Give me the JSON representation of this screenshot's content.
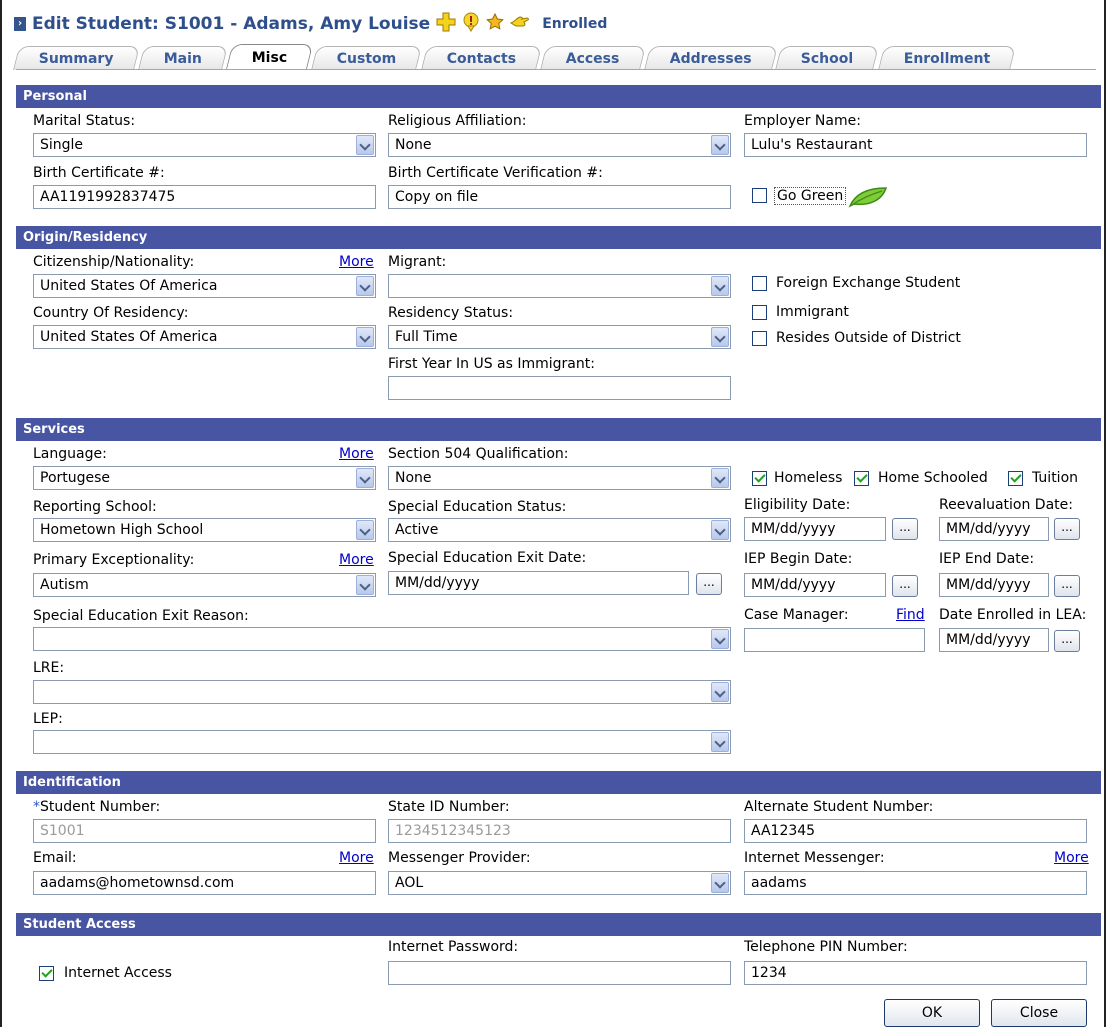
{
  "header": {
    "title": "Edit Student: S1001 - Adams, Amy Louise",
    "status": "Enrolled",
    "icons": [
      "plus-icon",
      "alert-icon",
      "star-icon",
      "hand-icon"
    ]
  },
  "tabs": [
    "Summary",
    "Main",
    "Misc",
    "Custom",
    "Contacts",
    "Access",
    "Addresses",
    "School",
    "Enrollment"
  ],
  "active_tab": "Misc",
  "personal": {
    "header": "Personal",
    "marital_status_label": "Marital Status:",
    "marital_status_value": "Single",
    "religious_label": "Religious Affiliation:",
    "religious_value": "None",
    "employer_label": "Employer Name:",
    "employer_value": "Lulu's Restaurant",
    "birth_cert_label": "Birth Certificate #:",
    "birth_cert_value": "AA1191992837475",
    "birth_verif_label": "Birth Certificate Verification #:",
    "birth_verif_value": "Copy on file",
    "go_green_label": "Go Green"
  },
  "origin": {
    "header": "Origin/Residency",
    "citizenship_label": "Citizenship/Nationality:",
    "more_label": "More",
    "citizenship_value": "United States Of America",
    "migrant_label": "Migrant:",
    "migrant_value": "",
    "foreign_exchange_label": "Foreign Exchange Student",
    "country_label": "Country Of Residency:",
    "country_value": "United States Of America",
    "residency_label": "Residency Status:",
    "residency_value": "Full Time",
    "immigrant_label": "Immigrant",
    "resides_label": "Resides Outside of District",
    "first_year_label": "First Year In US as Immigrant:",
    "first_year_value": ""
  },
  "services": {
    "header": "Services",
    "language_label": "Language:",
    "more_label": "More",
    "language_value": "Portugese",
    "section504_label": "Section 504 Qualification:",
    "section504_value": "None",
    "homeless_label": "Homeless",
    "home_schooled_label": "Home Schooled",
    "tuition_label": "Tuition",
    "reporting_school_label": "Reporting School:",
    "reporting_school_value": "Hometown High School",
    "sped_status_label": "Special Education Status:",
    "sped_status_value": "Active",
    "eligibility_label": "Eligibility Date:",
    "reevaluation_label": "Reevaluation Date:",
    "date_placeholder": "MM/dd/yyyy",
    "primary_exc_label": "Primary Exceptionality:",
    "primary_exc_value": "Autism",
    "sped_exit_date_label": "Special Education Exit Date:",
    "iep_begin_label": "IEP Begin Date:",
    "iep_end_label": "IEP End Date:",
    "sped_exit_reason_label": "Special Education Exit Reason:",
    "case_manager_label": "Case Manager:",
    "find_label": "Find",
    "date_enrolled_label": "Date Enrolled in LEA:",
    "lre_label": "LRE:",
    "lep_label": "LEP:",
    "dots": "..."
  },
  "identification": {
    "header": "Identification",
    "required_mark": "*",
    "student_number_label": "Student Number:",
    "student_number_value": "S1001",
    "state_id_label": "State ID Number:",
    "state_id_value": "1234512345123",
    "alt_number_label": "Alternate Student Number:",
    "alt_number_value": "AA12345",
    "email_label": "Email:",
    "more_label": "More",
    "email_value": "aadams@hometownsd.com",
    "messenger_provider_label": "Messenger Provider:",
    "messenger_provider_value": "AOL",
    "internet_messenger_label": "Internet Messenger:",
    "internet_messenger_value": "aadams"
  },
  "access": {
    "header": "Student Access",
    "internet_access_label": "Internet Access",
    "password_label": "Internet Password:",
    "password_value": "",
    "pin_label": "Telephone PIN Number:",
    "pin_value": "1234"
  },
  "buttons": {
    "ok": "OK",
    "close": "Close"
  }
}
